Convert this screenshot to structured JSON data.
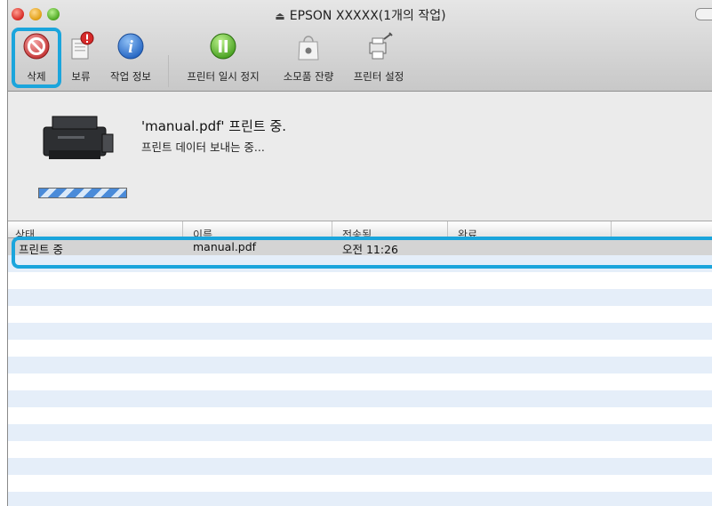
{
  "window": {
    "title": "EPSON XXXXX(1개의 작업)",
    "accent_color": "#1ba5dc"
  },
  "toolbar": {
    "delete_label": "삭제",
    "hold_label": "보류",
    "job_info_label": "작업 정보",
    "pause_label": "프린터 일시 정지",
    "supply_label": "소모품 잔량",
    "settings_label": "프린터 설정"
  },
  "status": {
    "job_title": "'manual.pdf' 프린트 중.",
    "job_subtitle": "프린트 데이터 보내는 중..."
  },
  "table": {
    "columns": [
      "상태",
      "이름",
      "전송됨",
      "완료"
    ],
    "rows": [
      {
        "status": "프린트 중",
        "name": "manual.pdf",
        "sent": "오전 11:26",
        "completed": ""
      }
    ]
  }
}
